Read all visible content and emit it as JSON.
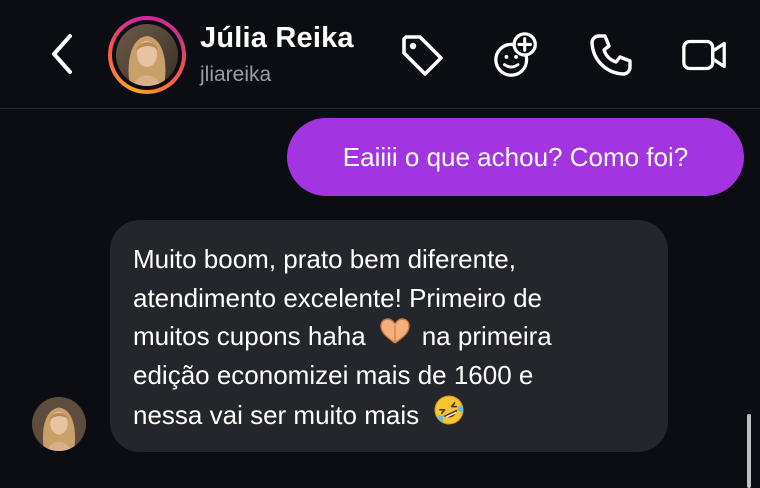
{
  "header": {
    "name": "Júlia Reika",
    "username": "jliareika",
    "back_icon": "chevron-left-icon",
    "icons": [
      "tag-icon",
      "sticker-add-icon",
      "phone-icon",
      "video-camera-icon"
    ]
  },
  "messages": {
    "outgoing": {
      "text": "Eaiiii o que achou? Como foi?"
    },
    "incoming": {
      "lines": [
        "Muito boom, prato bem diferente,",
        "atendimento excelente! Primeiro de",
        "muitos cupons haha",
        "na primeira",
        "edição economizei mais de 1600 e",
        "nessa vai ser muito mais"
      ],
      "emojis": [
        "heart-hands-emoji",
        "rolling-laughing-emoji"
      ]
    }
  },
  "colors": {
    "background": "#0c0d12",
    "outgoing_bubble": "#a235e0",
    "incoming_bubble": "#25262b",
    "secondary_text": "#9a9ca3"
  }
}
